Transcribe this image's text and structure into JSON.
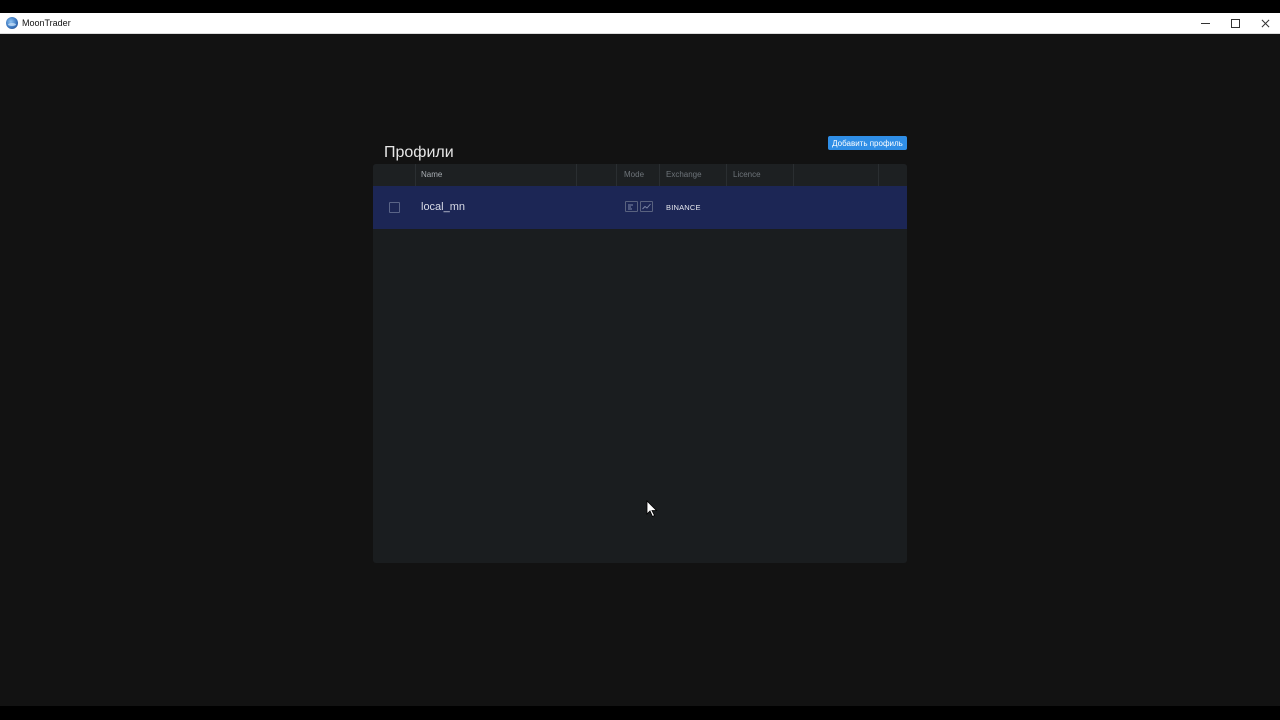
{
  "window": {
    "title": "MoonTrader",
    "controls": [
      "minimize-icon",
      "maximize-icon",
      "close-icon"
    ]
  },
  "page": {
    "title": "Профили",
    "add_button_label": "Добавить профиль"
  },
  "table": {
    "columns": {
      "name": "Name",
      "mode": "Mode",
      "exchange": "Exchange",
      "licence": "Licence"
    },
    "rows": [
      {
        "name": "local_mn",
        "mode_icons": [
          "terminal-icon",
          "chart-icon"
        ],
        "exchange": "BINANCE",
        "licence": "",
        "selected": true,
        "checked": false
      }
    ]
  },
  "colors": {
    "accent": "#2f8ee6",
    "selected_row": "#1c2655",
    "background": "#121212",
    "panel": "#1a1d1f"
  }
}
